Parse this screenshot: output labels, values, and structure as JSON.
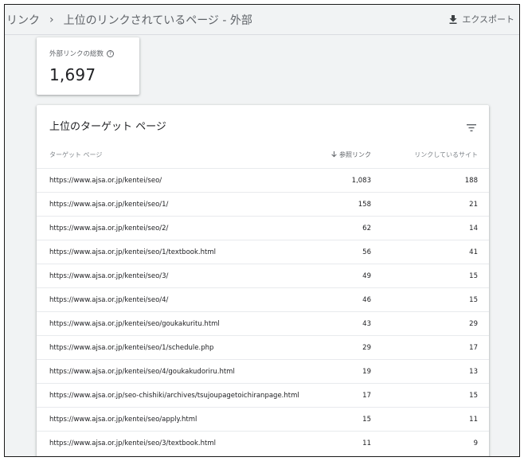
{
  "breadcrumb": {
    "parent": "リンク",
    "separator": "›",
    "current": "上位のリンクされているページ - 外部"
  },
  "export": {
    "icon": "download-icon",
    "label": "エクスポート"
  },
  "metric": {
    "label": "外部リンクの総数",
    "help_icon": "help-icon",
    "value": "1,697"
  },
  "table": {
    "title": "上位のターゲット ページ",
    "filter_icon": "filter-icon",
    "columns": {
      "page": "ターゲット ページ",
      "refs": "参照リンク",
      "refs_sort_icon": "arrow-down-icon",
      "sites": "リンクしているサイト"
    },
    "rows": [
      {
        "page": "https://www.ajsa.or.jp/kentei/seo/",
        "refs": "1,083",
        "sites": "188"
      },
      {
        "page": "https://www.ajsa.or.jp/kentei/seo/1/",
        "refs": "158",
        "sites": "21"
      },
      {
        "page": "https://www.ajsa.or.jp/kentei/seo/2/",
        "refs": "62",
        "sites": "14"
      },
      {
        "page": "https://www.ajsa.or.jp/kentei/seo/1/textbook.html",
        "refs": "56",
        "sites": "41"
      },
      {
        "page": "https://www.ajsa.or.jp/kentei/seo/3/",
        "refs": "49",
        "sites": "15"
      },
      {
        "page": "https://www.ajsa.or.jp/kentei/seo/4/",
        "refs": "46",
        "sites": "15"
      },
      {
        "page": "https://www.ajsa.or.jp/kentei/seo/goukakuritu.html",
        "refs": "43",
        "sites": "29"
      },
      {
        "page": "https://www.ajsa.or.jp/kentei/seo/1/schedule.php",
        "refs": "29",
        "sites": "17"
      },
      {
        "page": "https://www.ajsa.or.jp/kentei/seo/4/goukakudoriru.html",
        "refs": "19",
        "sites": "13"
      },
      {
        "page": "https://www.ajsa.or.jp/seo-chishiki/archives/tsujoupagetoichiranpage.html",
        "refs": "17",
        "sites": "15"
      },
      {
        "page": "https://www.ajsa.or.jp/kentei/seo/apply.html",
        "refs": "15",
        "sites": "11"
      },
      {
        "page": "https://www.ajsa.or.jp/kentei/seo/3/textbook.html",
        "refs": "11",
        "sites": "9"
      }
    ]
  }
}
